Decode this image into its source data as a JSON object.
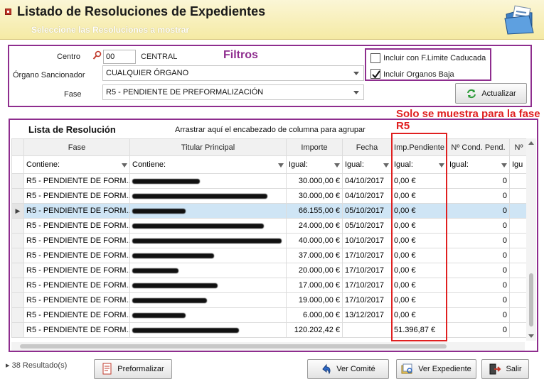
{
  "header": {
    "title": "Listado de Resoluciones de Expedientes",
    "subtitle": "Seleccione las Resoluciones a mostrar"
  },
  "filters": {
    "annotation": "Filtros",
    "centro_label": "Centro",
    "centro_code": "00",
    "centro_name": "CENTRAL",
    "organo_label": "Órgano Sancionador",
    "organo_value": "CUALQUIER ÓRGANO",
    "fase_label": "Fase",
    "fase_value": "R5 - PENDIENTE DE PREFORMALIZACIÓN",
    "chk_caducada_label": "Incluir con F.Limite Caducada",
    "chk_caducada_checked": false,
    "chk_baja_label": "Incluir Organos Baja",
    "chk_baja_checked": true,
    "actualizar_label": "Actualizar"
  },
  "grid": {
    "title": "Lista de Resolución",
    "group_hint": "Arrastrar aquí el encabezado de columna para agrupar",
    "note": "Solo se muestra para la fase R5",
    "columns": [
      "Fase",
      "Titular Principal",
      "Importe",
      "Fecha",
      "Imp.Pendiente",
      "Nº Cond. Pend.",
      "Nº"
    ],
    "filters": [
      "Contiene:",
      "Contiene:",
      "Igual:",
      "Igual:",
      "Igual:",
      "Igual:",
      "Igu"
    ],
    "rows": [
      {
        "fase": "R5 - PENDIENTE DE FORM...",
        "importe": "30.000,00 €",
        "fecha": "04/10/2017",
        "pendiente": "0,00 €",
        "cond": "0",
        "selected": false
      },
      {
        "fase": "R5 - PENDIENTE DE FORM...",
        "importe": "30.000,00 €",
        "fecha": "04/10/2017",
        "pendiente": "0,00 €",
        "cond": "0",
        "selected": false
      },
      {
        "fase": "R5 - PENDIENTE DE FORM...",
        "importe": "66.155,00 €",
        "fecha": "05/10/2017",
        "pendiente": "0,00 €",
        "cond": "0",
        "selected": true
      },
      {
        "fase": "R5 - PENDIENTE DE FORM...",
        "importe": "24.000,00 €",
        "fecha": "05/10/2017",
        "pendiente": "0,00 €",
        "cond": "0",
        "selected": false
      },
      {
        "fase": "R5 - PENDIENTE DE FORM...",
        "importe": "40.000,00 €",
        "fecha": "10/10/2017",
        "pendiente": "0,00 €",
        "cond": "0",
        "selected": false
      },
      {
        "fase": "R5 - PENDIENTE DE FORM...",
        "importe": "37.000,00 €",
        "fecha": "17/10/2017",
        "pendiente": "0,00 €",
        "cond": "0",
        "selected": false
      },
      {
        "fase": "R5 - PENDIENTE DE FORM...",
        "importe": "20.000,00 €",
        "fecha": "17/10/2017",
        "pendiente": "0,00 €",
        "cond": "0",
        "selected": false
      },
      {
        "fase": "R5 - PENDIENTE DE FORM...",
        "importe": "17.000,00 €",
        "fecha": "17/10/2017",
        "pendiente": "0,00 €",
        "cond": "0",
        "selected": false
      },
      {
        "fase": "R5 - PENDIENTE DE FORM...",
        "importe": "19.000,00 €",
        "fecha": "17/10/2017",
        "pendiente": "0,00 €",
        "cond": "0",
        "selected": false
      },
      {
        "fase": "R5 - PENDIENTE DE FORM...",
        "importe": "6.000,00 €",
        "fecha": "13/12/2017",
        "pendiente": "0,00 €",
        "cond": "0",
        "selected": false
      },
      {
        "fase": "R5 - PENDIENTE DE FORM...",
        "importe": "120.202,42 €",
        "fecha": "",
        "pendiente": "51.396,87 €",
        "cond": "0",
        "selected": false
      }
    ]
  },
  "footer": {
    "results": "38 Resultado(s)",
    "preformalizar": "Preformalizar",
    "ver_comite": "Ver Comité",
    "ver_expediente": "Ver Expediente",
    "salir": "Salir"
  },
  "colors": {
    "annotation_purple": "#8e2d8e",
    "annotation_red": "#e02020",
    "header_bg": "#f5eaa4",
    "selected_row": "#cfe5f5"
  }
}
